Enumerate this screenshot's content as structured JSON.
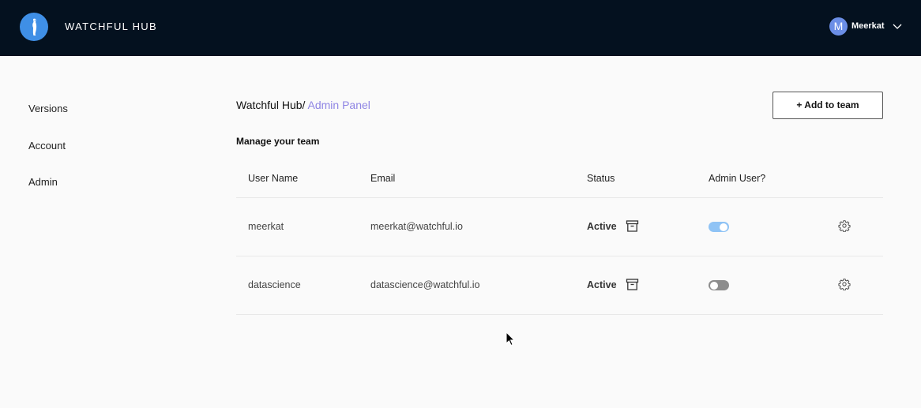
{
  "header": {
    "app_title": "WATCHFUL HUB",
    "logo_icon": "meerkat-logo-icon",
    "user": {
      "initial": "M",
      "name": "Meerkat",
      "menu_icon": "chevron-down-icon"
    },
    "background": "#04111f"
  },
  "sidebar": {
    "items": [
      {
        "label": "Versions"
      },
      {
        "label": "Account"
      },
      {
        "label": "Admin"
      }
    ]
  },
  "breadcrumb": {
    "home": "Watchful Hub/",
    "current": " Admin Panel",
    "current_color": "#8f85e4"
  },
  "actions": {
    "add_to_team": "+ Add to team"
  },
  "team": {
    "title": "Manage your team",
    "columns": [
      "User Name",
      "Email",
      "Status",
      "Admin User?"
    ],
    "rows": [
      {
        "username": "meerkat",
        "email": "meerkat@watchful.io",
        "status": "Active",
        "admin": true
      },
      {
        "username": "datascience",
        "email": "datascience@watchful.io",
        "status": "Active",
        "admin": false
      }
    ]
  },
  "colors": {
    "toggle_on": "#8fc3f5",
    "toggle_off": "#8d8d8d",
    "accent": "#8f85e4"
  }
}
